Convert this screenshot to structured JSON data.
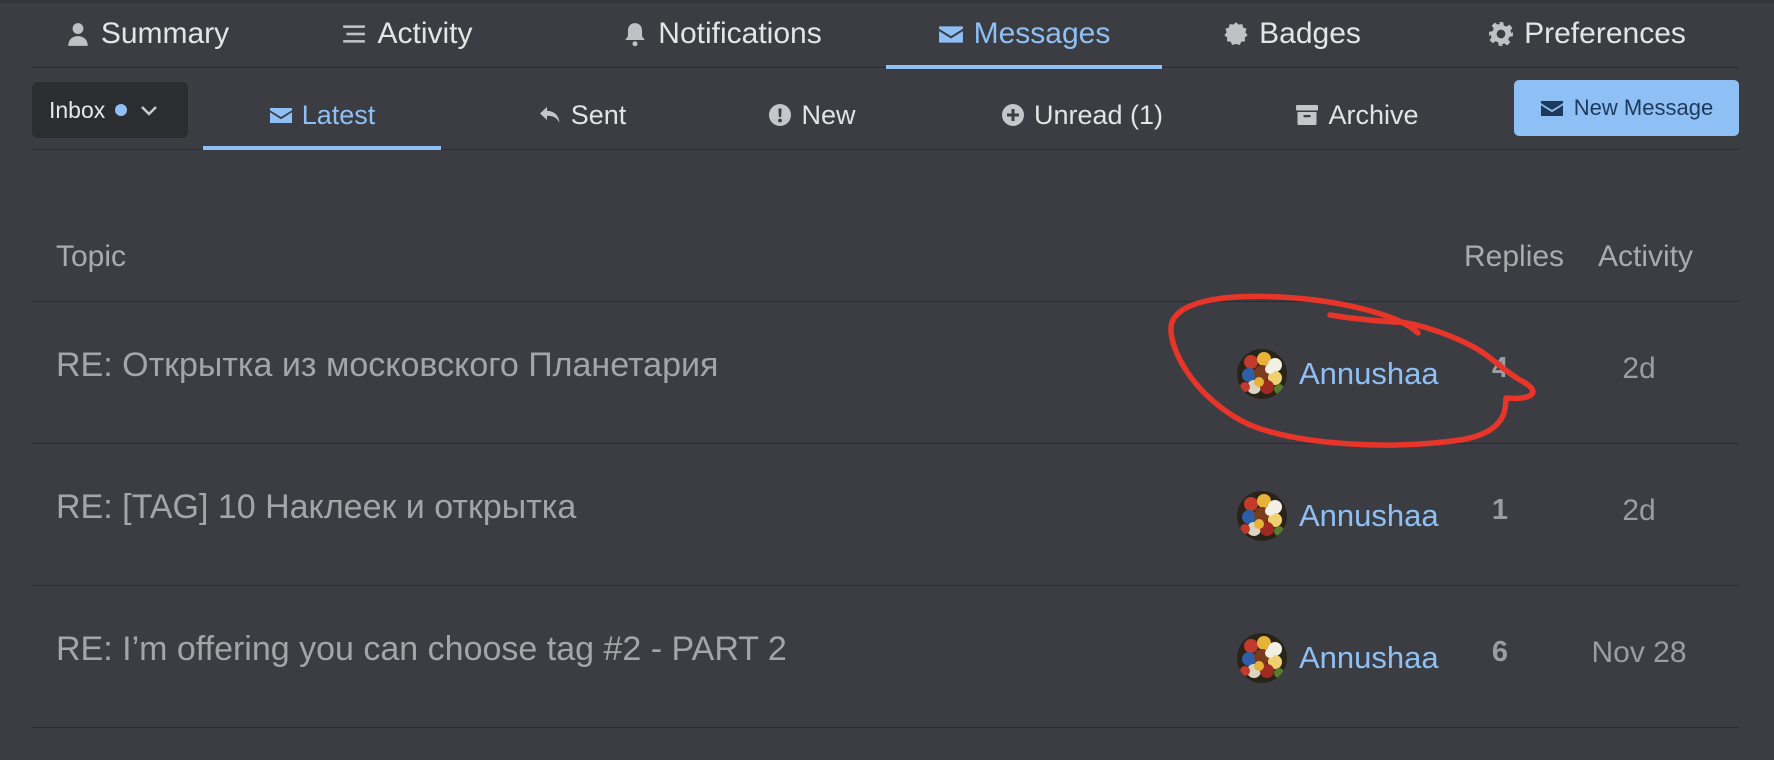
{
  "user_nav": {
    "tabs": [
      {
        "label": "Summary",
        "icon": "user-icon"
      },
      {
        "label": "Activity",
        "icon": "stream-icon"
      },
      {
        "label": "Notifications",
        "icon": "bell-icon"
      },
      {
        "label": "Messages",
        "icon": "envelope-icon",
        "active": true
      },
      {
        "label": "Badges",
        "icon": "certificate-icon"
      },
      {
        "label": "Preferences",
        "icon": "gear-icon"
      }
    ]
  },
  "messages_nav": {
    "inbox_label": "Inbox",
    "tabs": [
      {
        "label": "Latest",
        "icon": "envelope-icon",
        "active": true
      },
      {
        "label": "Sent",
        "icon": "reply-icon"
      },
      {
        "label": "New",
        "icon": "exclamation-circle-icon"
      },
      {
        "label": "Unread (1)",
        "icon": "plus-circle-icon"
      },
      {
        "label": "Archive",
        "icon": "archive-icon"
      }
    ],
    "new_message_label": "New Message"
  },
  "table": {
    "headers": {
      "topic": "Topic",
      "replies": "Replies",
      "activity": "Activity"
    },
    "rows": [
      {
        "title": "RE: Открытка из московского Планетария",
        "poster": "Annushaa",
        "replies": "4",
        "activity": "2d"
      },
      {
        "title": "RE: [TAG] 10 Наклеек и открытка",
        "poster": "Annushaa",
        "replies": "1",
        "activity": "2d"
      },
      {
        "title": "RE: I’m offering you can choose tag #2 - PART 2",
        "poster": "Annushaa",
        "replies": "6",
        "activity": "Nov 28"
      }
    ]
  },
  "colors": {
    "background": "#3b3d42",
    "accent": "#8fc0f5",
    "annotation": "#e8352a"
  }
}
